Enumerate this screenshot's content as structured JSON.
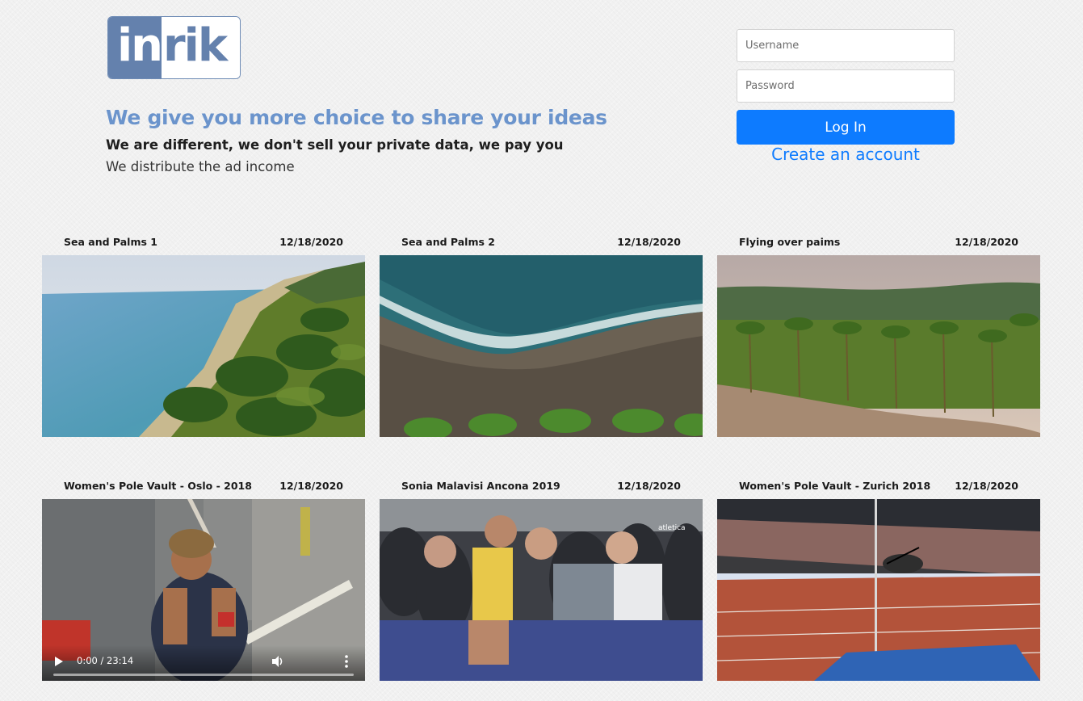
{
  "brand": {
    "logo_left": "in",
    "logo_right": "rik"
  },
  "hero": {
    "tagline": "We give you more choice to share your ideas",
    "subtagline": "We are different, we don't sell your private data, we pay you",
    "subtext": "We distribute the ad income"
  },
  "login": {
    "username_placeholder": "Username",
    "password_placeholder": "Password",
    "login_label": "Log In",
    "create_account_label": "Create an account"
  },
  "videos": [
    {
      "title": "Sea and Palms 1",
      "date": "12/18/2020"
    },
    {
      "title": "Sea and Palms 2",
      "date": "12/18/2020"
    },
    {
      "title": "Flying over paims",
      "date": "12/18/2020"
    },
    {
      "title": "Women's Pole Vault - Oslo - 2018",
      "date": "12/18/2020",
      "player": {
        "time": "0:00 / 23:14"
      }
    },
    {
      "title": "Sonia Malavisi Ancona 2019",
      "date": "12/18/2020"
    },
    {
      "title": "Women's Pole Vault - Zurich 2018",
      "date": "12/18/2020"
    }
  ],
  "colors": {
    "brand_blue": "#6481ad",
    "tagline_blue": "#6b94cc",
    "primary_button": "#0d7bff",
    "page_background": "#f1f1f1"
  },
  "icons": {
    "play": "play-icon",
    "volume": "volume-icon",
    "more": "more-vertical-icon"
  }
}
